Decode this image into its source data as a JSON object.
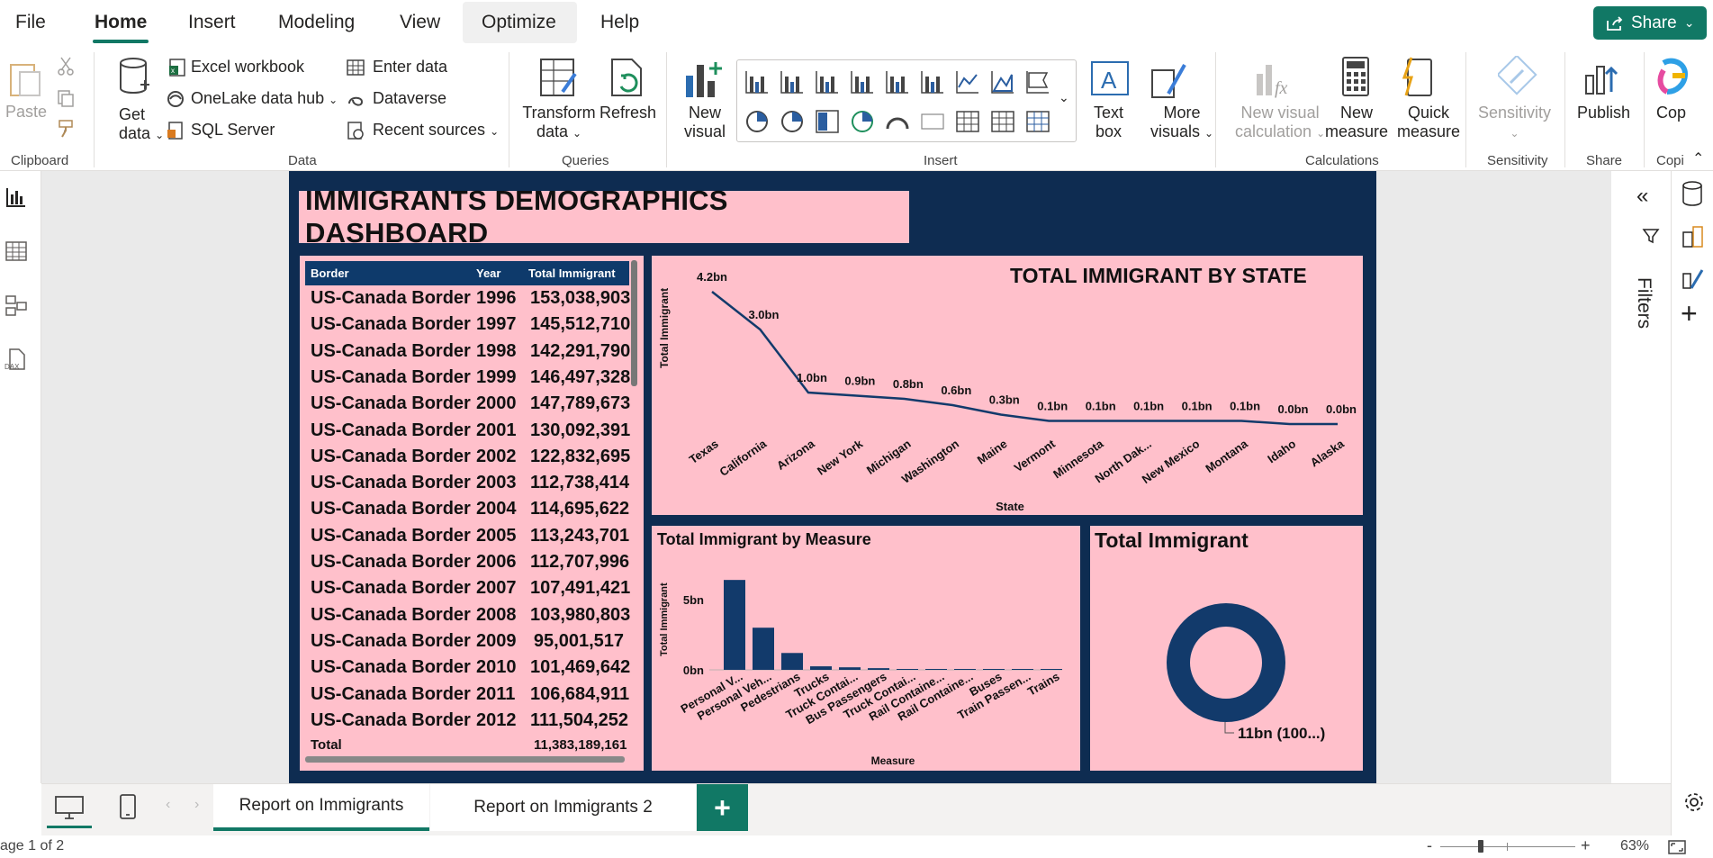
{
  "menu": {
    "items": [
      "File",
      "Home",
      "Insert",
      "Modeling",
      "View",
      "Optimize",
      "Help"
    ],
    "active": "Home",
    "share_label": "Share"
  },
  "ribbon": {
    "clipboard": {
      "paste": "Paste",
      "group": "Clipboard"
    },
    "data": {
      "get_data": [
        "Get",
        "data"
      ],
      "excel": "Excel workbook",
      "onelake": "OneLake data hub",
      "sql": "SQL Server",
      "enter_data": "Enter data",
      "dataverse": "Dataverse",
      "recent": "Recent sources",
      "group": "Data"
    },
    "queries": {
      "transform": [
        "Transform",
        "data"
      ],
      "refresh": "Refresh",
      "group": "Queries"
    },
    "insert": {
      "new_visual": [
        "New",
        "visual"
      ],
      "text_box": [
        "Text",
        "box"
      ],
      "more_visuals": [
        "More",
        "visuals"
      ],
      "group": "Insert"
    },
    "calculations": {
      "new_visual_calc": [
        "New visual",
        "calculation"
      ],
      "new_measure": [
        "New",
        "measure"
      ],
      "quick_measure": [
        "Quick",
        "measure"
      ],
      "group": "Calculations"
    },
    "sensitivity": {
      "label": "Sensitivity",
      "group": "Sensitivity"
    },
    "share": {
      "publish": "Publish",
      "group": "Share"
    },
    "copilot": {
      "label": "Cop",
      "group": "Copi"
    }
  },
  "dashboard": {
    "title": "IMMIGRANTS DEMOGRAPHICS DASHBOARD",
    "table": {
      "headers": [
        "Border",
        "Year",
        "Total Immigrant"
      ],
      "rows": [
        [
          "US-Canada Border",
          "1996",
          "153,038,903"
        ],
        [
          "US-Canada Border",
          "1997",
          "145,512,710"
        ],
        [
          "US-Canada Border",
          "1998",
          "142,291,790"
        ],
        [
          "US-Canada Border",
          "1999",
          "146,497,328"
        ],
        [
          "US-Canada Border",
          "2000",
          "147,789,673"
        ],
        [
          "US-Canada Border",
          "2001",
          "130,092,391"
        ],
        [
          "US-Canada Border",
          "2002",
          "122,832,695"
        ],
        [
          "US-Canada Border",
          "2003",
          "112,738,414"
        ],
        [
          "US-Canada Border",
          "2004",
          "114,695,622"
        ],
        [
          "US-Canada Border",
          "2005",
          "113,243,701"
        ],
        [
          "US-Canada Border",
          "2006",
          "112,707,996"
        ],
        [
          "US-Canada Border",
          "2007",
          "107,491,421"
        ],
        [
          "US-Canada Border",
          "2008",
          "103,980,803"
        ],
        [
          "US-Canada Border",
          "2009",
          "95,001,517"
        ],
        [
          "US-Canada Border",
          "2010",
          "101,469,642"
        ],
        [
          "US-Canada Border",
          "2011",
          "106,684,911"
        ],
        [
          "US-Canada Border",
          "2012",
          "111,504,252"
        ]
      ],
      "total_label": "Total",
      "total_value": "11,383,189,161"
    }
  },
  "chart_data": [
    {
      "type": "line",
      "title": "TOTAL IMMIGRANT BY STATE",
      "xlabel": "State",
      "ylabel": "Total Immigrant",
      "categories": [
        "Texas",
        "California",
        "Arizona",
        "New York",
        "Michigan",
        "Washington",
        "Maine",
        "Vermont",
        "Minnesota",
        "North Dak...",
        "New Mexico",
        "Montana",
        "Idaho",
        "Alaska"
      ],
      "values": [
        4.2,
        3.0,
        1.0,
        0.9,
        0.8,
        0.6,
        0.3,
        0.1,
        0.1,
        0.1,
        0.1,
        0.1,
        0.0,
        0.0
      ],
      "data_labels": [
        "4.2bn",
        "3.0bn",
        "1.0bn",
        "0.9bn",
        "0.8bn",
        "0.6bn",
        "0.3bn",
        "0.1bn",
        "0.1bn",
        "0.1bn",
        "0.1bn",
        "0.1bn",
        "0.0bn",
        "0.0bn"
      ],
      "unit": "bn",
      "color": "#123a6b"
    },
    {
      "type": "bar",
      "title": "Total Immigrant by Measure",
      "xlabel": "Measure",
      "ylabel": "Total Immigrant",
      "y_ticks": [
        "5bn",
        "0bn"
      ],
      "y_tick_values": [
        5,
        0
      ],
      "categories": [
        "Personal V...",
        "Personal Veh...",
        "Pedestrians",
        "Trucks",
        "Truck Contai...",
        "Bus Passengers",
        "Truck Contai...",
        "Rail Containe...",
        "Rail Containe...",
        "Buses",
        "Train Passen...",
        "Trains"
      ],
      "values": [
        6.4,
        3.0,
        1.2,
        0.25,
        0.18,
        0.12,
        0.06,
        0.04,
        0.03,
        0.02,
        0.02,
        0.01
      ],
      "unit": "bn",
      "color": "#123a6b"
    },
    {
      "type": "pie",
      "title": "Total Immigrant",
      "slices": [
        {
          "label": "11bn (100...)",
          "value": 100
        }
      ],
      "donut": true,
      "color": "#123a6b"
    }
  ],
  "right_pane": {
    "filters_label": "Filters"
  },
  "tabs": {
    "pages": [
      "Report on Immigrants",
      "Report on Immigrants 2"
    ],
    "active": "Report on Immigrants",
    "add": "+"
  },
  "status": {
    "page": "age 1 of 2",
    "zoom": "63%",
    "minus": "-",
    "plus": "+"
  }
}
